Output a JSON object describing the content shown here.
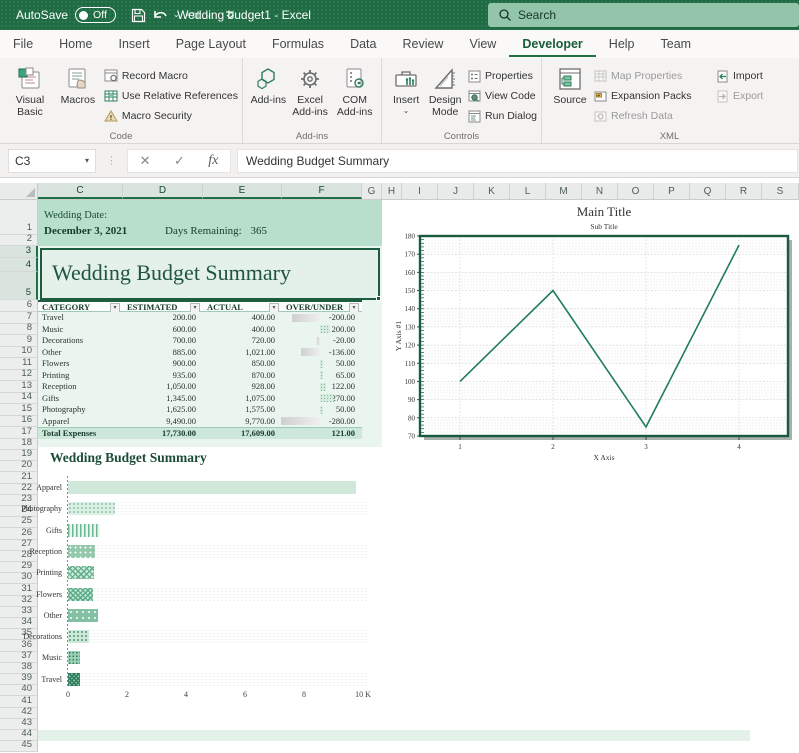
{
  "titlebar": {
    "autosave_label": "AutoSave",
    "autosave_state": "Off",
    "title": "Wedding budget1  -  Excel",
    "search_placeholder": "Search"
  },
  "tabs": {
    "items": [
      "File",
      "Home",
      "Insert",
      "Page Layout",
      "Formulas",
      "Data",
      "Review",
      "View",
      "Developer",
      "Help",
      "Team"
    ],
    "active": "Developer"
  },
  "ribbon": {
    "code": {
      "label": "Code",
      "visual_basic": "Visual Basic",
      "macros": "Macros",
      "record_macro": "Record Macro",
      "use_relative_references": "Use Relative References",
      "macro_security": "Macro Security"
    },
    "addins": {
      "label": "Add-ins",
      "addins": "Add-ins",
      "excel_addins": "Excel Add-ins",
      "com_addins": "COM Add-ins"
    },
    "controls": {
      "label": "Controls",
      "insert": "Insert",
      "design_mode": "Design Mode",
      "properties": "Properties",
      "view_code": "View Code",
      "run_dialog": "Run Dialog"
    },
    "xml": {
      "label": "XML",
      "source": "Source",
      "map_properties": "Map Properties",
      "expansion_packs": "Expansion Packs",
      "refresh_data": "Refresh Data",
      "import": "Import",
      "export": "Export"
    }
  },
  "formula_bar": {
    "name_box": "C3",
    "fx": "fx",
    "formula": "Wedding Budget Summary"
  },
  "grid": {
    "columns": [
      "C",
      "D",
      "E",
      "F",
      "G",
      "H",
      "I",
      "J",
      "K",
      "L",
      "M",
      "N",
      "O",
      "P",
      "Q",
      "R",
      "S"
    ],
    "selected_columns": [
      "C",
      "D",
      "E",
      "F"
    ],
    "row_start": 1,
    "row_end": 45,
    "selected_rows": [
      3,
      4,
      5
    ]
  },
  "sheet": {
    "wedding_date_label": "Wedding Date:",
    "wedding_date": "December 3, 2021",
    "days_remaining_label": "Days Remaining:",
    "days_remaining": "365",
    "summary_title": "Wedding Budget Summary",
    "table": {
      "headers": [
        "CATEGORY",
        "ESTIMATED",
        "ACTUAL",
        "OVER/UNDER"
      ],
      "rows": [
        [
          "Travel",
          "200.00",
          "400.00",
          "-200.00"
        ],
        [
          "Music",
          "600.00",
          "400.00",
          "200.00"
        ],
        [
          "Decorations",
          "700.00",
          "720.00",
          "-20.00"
        ],
        [
          "Other",
          "885.00",
          "1,021.00",
          "-136.00"
        ],
        [
          "Flowers",
          "900.00",
          "850.00",
          "50.00"
        ],
        [
          "Printing",
          "935.00",
          "870.00",
          "65.00"
        ],
        [
          "Reception",
          "1,050.00",
          "928.00",
          "122.00"
        ],
        [
          "Gifts",
          "1,345.00",
          "1,075.00",
          "270.00"
        ],
        [
          "Photography",
          "1,625.00",
          "1,575.00",
          "50.00"
        ],
        [
          "Apparel",
          "9,490.00",
          "9,770.00",
          "-280.00"
        ]
      ],
      "total_row": [
        "Total Expenses",
        "17,730.00",
        "17,609.00",
        "121.00"
      ]
    }
  },
  "chart_data": [
    {
      "type": "bar",
      "orientation": "horizontal",
      "title": "Wedding Budget Summary",
      "categories": [
        "Apparel",
        "Photography",
        "Gifts",
        "Reception",
        "Printing",
        "Flowers",
        "Other",
        "Decorations",
        "Music",
        "Travel"
      ],
      "values": [
        9770,
        1575,
        1075,
        928,
        870,
        850,
        1021,
        720,
        400,
        400
      ],
      "xlim": [
        0,
        10000
      ],
      "xticks": [
        0,
        2000,
        4000,
        6000,
        8000,
        10000
      ],
      "xtick_labels": [
        "0",
        "2",
        "4",
        "6",
        "8",
        "10 K"
      ],
      "legend": "none",
      "grid": "off"
    },
    {
      "type": "line",
      "title": "Main Title",
      "subtitle": "Sub Title",
      "xlabel": "X Axis",
      "ylabel": "Y Axis #1",
      "x": [
        1,
        2,
        3,
        4
      ],
      "y": [
        100,
        150,
        75,
        175
      ],
      "ylim": [
        70,
        180
      ],
      "ytick_step": 10,
      "xticks": [
        1,
        2,
        3,
        4
      ],
      "line_color": "#217c5d",
      "grid": "on",
      "legend": "none"
    }
  ]
}
